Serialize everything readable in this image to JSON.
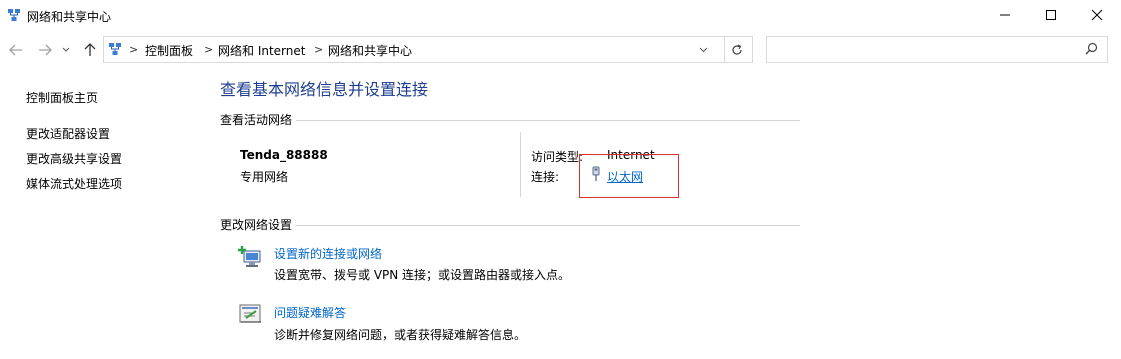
{
  "window": {
    "title": "网络和共享中心",
    "controls": {
      "minimize": "—",
      "maximize": "☐",
      "close": "✕"
    }
  },
  "address_bar": {
    "breadcrumbs": [
      "控制面板",
      "网络和 Internet",
      "网络和共享中心"
    ],
    "separator": ">",
    "search_placeholder": ""
  },
  "sidebar": {
    "items": [
      {
        "label": "控制面板主页"
      },
      {
        "label": "更改适配器设置"
      },
      {
        "label": "更改高级共享设置"
      },
      {
        "label": "媒体流式处理选项"
      }
    ]
  },
  "main": {
    "heading": "查看基本网络信息并设置连接",
    "active_networks": {
      "section_title": "查看活动网络",
      "network_name": "Tenda_88888",
      "network_type": "专用网络",
      "access_type_label": "访问类型:",
      "access_type_value": "Internet",
      "connection_label": "连接:",
      "connection_value": "以太网"
    },
    "change_settings": {
      "section_title": "更改网络设置",
      "items": [
        {
          "title": "设置新的连接或网络",
          "description": "设置宽带、拨号或 VPN 连接；或设置路由器或接入点。",
          "icon": "new-connection-icon"
        },
        {
          "title": "问题疑难解答",
          "description": "诊断并修复网络问题，或者获得疑难解答信息。",
          "icon": "troubleshoot-icon"
        }
      ]
    }
  },
  "colors": {
    "heading": "#1e3f8f",
    "link": "#0066cc",
    "highlight_box": "#d9302b"
  }
}
